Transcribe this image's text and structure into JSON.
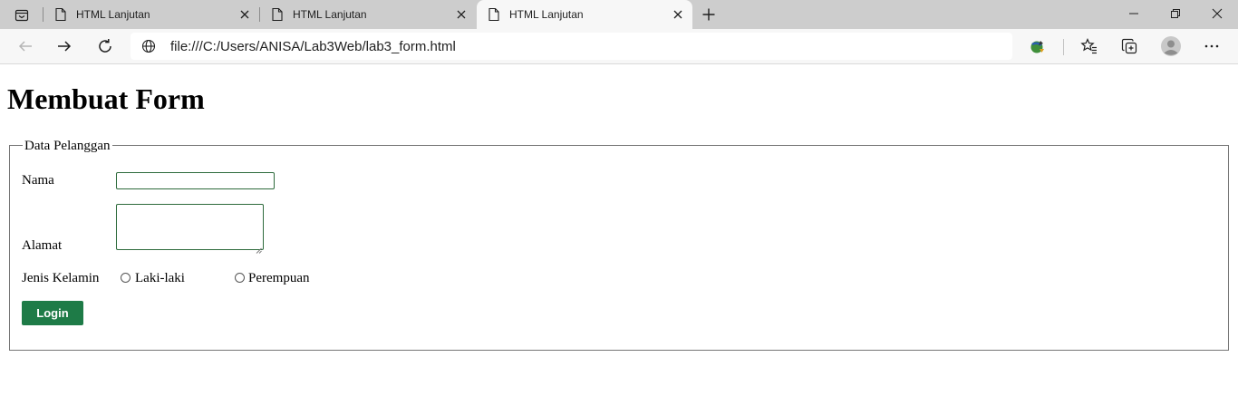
{
  "tabs": [
    {
      "title": "HTML Lanjutan",
      "active": false
    },
    {
      "title": "HTML Lanjutan",
      "active": false
    },
    {
      "title": "HTML Lanjutan",
      "active": true
    }
  ],
  "address": {
    "url": "file:///C:/Users/ANISA/Lab3Web/lab3_form.html"
  },
  "page": {
    "heading": "Membuat Form",
    "form": {
      "legend": "Data Pelanggan",
      "nama_label": "Nama",
      "nama_value": "",
      "alamat_label": "Alamat",
      "alamat_value": "",
      "gender_label": "Jenis Kelamin",
      "gender_options": [
        "Laki-laki",
        "Perempuan"
      ],
      "login_label": "Login"
    }
  },
  "colors": {
    "login_button": "#1e7b47",
    "input_border": "#2e6b3c",
    "tabstrip": "#cdcdcd",
    "toolbar": "#f7f7f7"
  },
  "icons": {
    "tab_actions": "tab-actions-icon",
    "page": "page-icon",
    "close": "close-icon",
    "new_tab": "plus-icon",
    "back": "back-arrow-icon",
    "forward": "forward-arrow-icon",
    "refresh": "refresh-icon",
    "site_info": "globe-icon",
    "extension": "download-manager-icon",
    "favorites": "favorites-icon",
    "collections": "collections-icon",
    "profile": "profile-icon",
    "menu": "more-icon"
  }
}
